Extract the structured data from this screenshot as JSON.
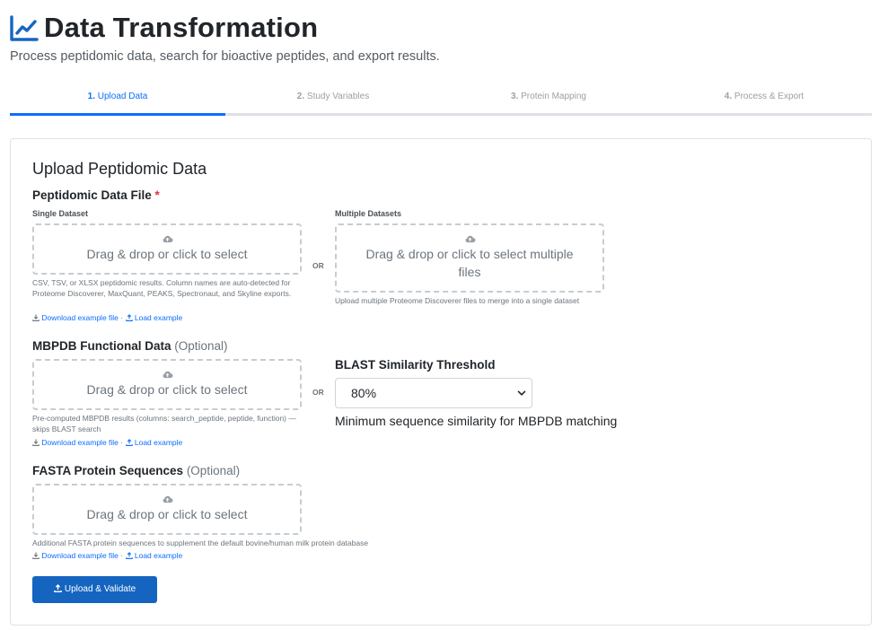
{
  "header": {
    "title_icon": "line-chart-icon",
    "title": "Data Transformation",
    "subtitle": "Process peptidomic data, search for bioactive peptides, and export results."
  },
  "tabs": [
    {
      "num": "1.",
      "label": "Upload Data",
      "active": true
    },
    {
      "num": "2.",
      "label": "Study Variables",
      "active": false
    },
    {
      "num": "3.",
      "label": "Protein Mapping",
      "active": false
    },
    {
      "num": "4.",
      "label": "Process & Export",
      "active": false
    }
  ],
  "card": {
    "title": "Upload Peptidomic Data",
    "peptidomic": {
      "label": "Peptidomic Data File",
      "required_mark": "*",
      "single": {
        "label": "Single Dataset",
        "drop_text": "Drag & drop or click to select",
        "help": "CSV, TSV, or XLSX peptidomic results. Column names are auto-detected for Proteome Discoverer, MaxQuant, PEAKS, Spectronaut, and Skyline exports.",
        "download_link": "Download example file",
        "load_link": "Load example"
      },
      "or": "OR",
      "multiple": {
        "label": "Multiple Datasets",
        "drop_text": "Drag & drop or click to select multiple files",
        "help": "Upload multiple Proteome Discoverer files to merge into a single dataset"
      }
    },
    "mbpdb": {
      "label": "MBPDB Functional Data",
      "optional": "(Optional)",
      "drop_text": "Drag & drop or click to select",
      "help": "Pre-computed MBPDB results (columns: search_peptide, peptide, function) — skips BLAST search",
      "download_link": "Download example file",
      "load_link": "Load example",
      "or": "OR"
    },
    "blast": {
      "label": "BLAST Similarity Threshold",
      "selected": "80%",
      "help": "Minimum sequence similarity for MBPDB matching"
    },
    "fasta": {
      "label": "FASTA Protein Sequences",
      "optional": "(Optional)",
      "drop_text": "Drag & drop or click to select",
      "help": "Additional FASTA protein sequences to supplement the default bovine/human milk protein database",
      "download_link": "Download example file",
      "load_link": "Load example"
    },
    "submit_label": "Upload & Validate",
    "link_separator": "·"
  },
  "colors": {
    "primary": "#0d6efd",
    "button": "#1565c0",
    "required": "#dc3545",
    "muted": "#6c757d"
  }
}
